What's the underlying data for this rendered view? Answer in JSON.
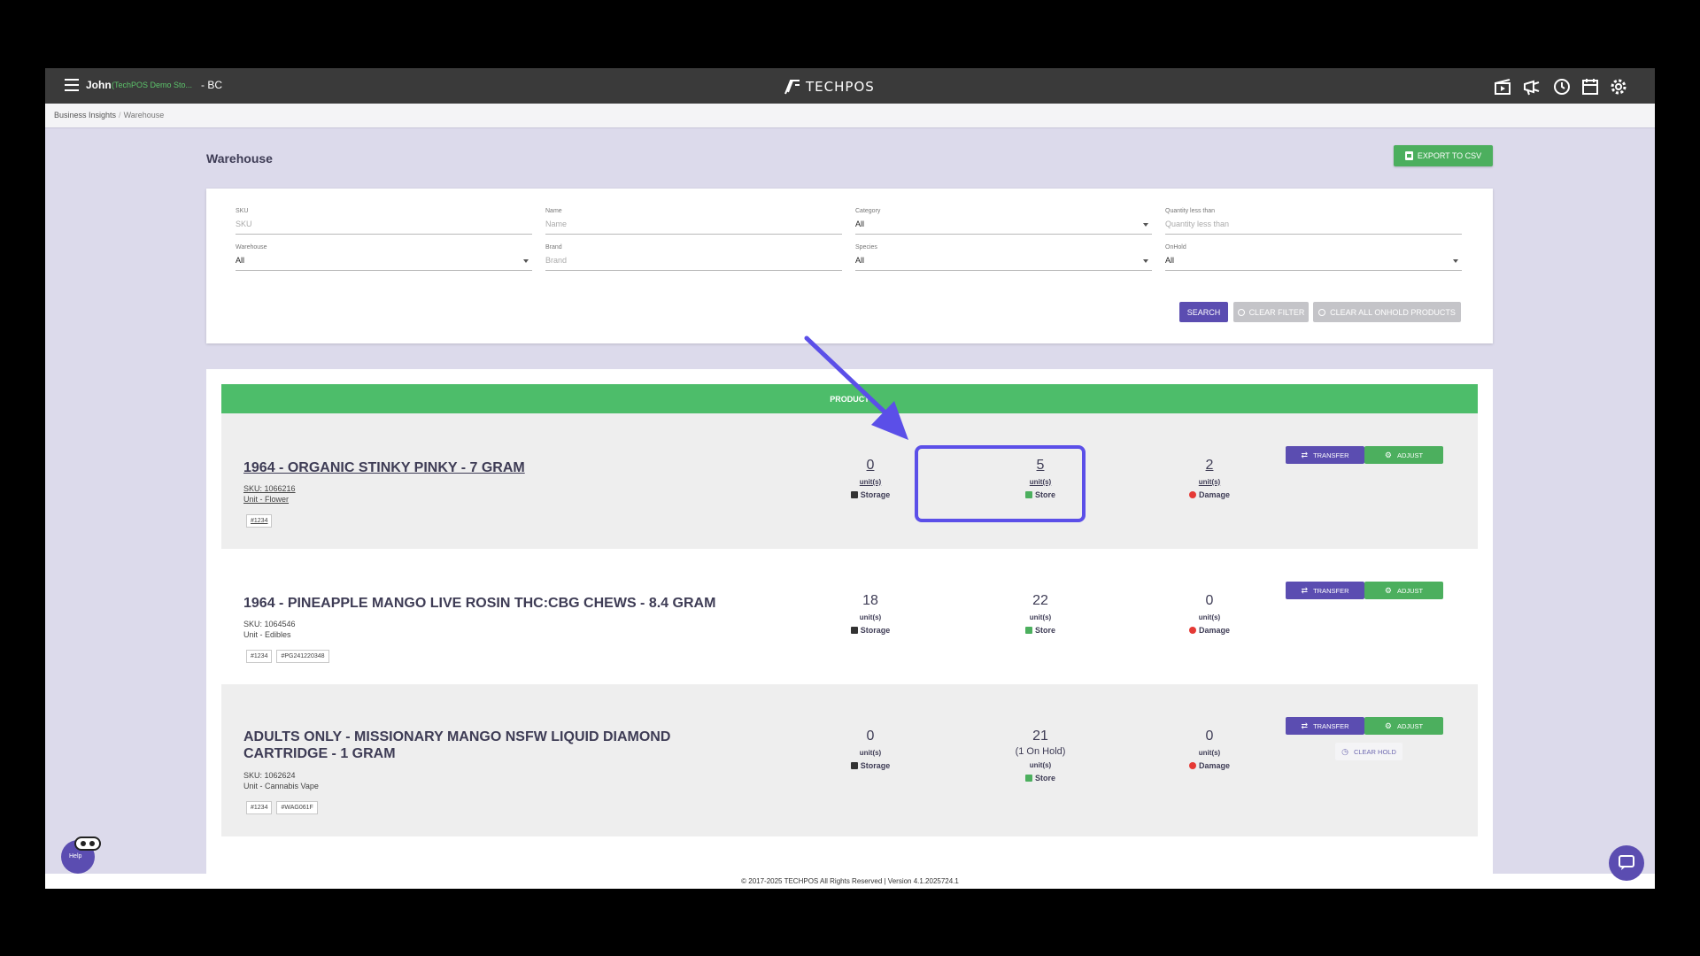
{
  "topbar": {
    "user": "John",
    "store": "(TechPOS Demo Sto...",
    "region": "- BC",
    "logo_text": "TECHPOS",
    "icons": [
      "film-icon",
      "megaphone-icon",
      "clock-icon",
      "calendar-icon",
      "gear-icon"
    ]
  },
  "breadcrumb": {
    "root": "Business Insights",
    "sep": "/",
    "current": "Warehouse"
  },
  "page": {
    "title": "Warehouse",
    "export_label": "EXPORT TO CSV"
  },
  "filters": {
    "sku": {
      "label": "SKU",
      "placeholder": "SKU"
    },
    "name": {
      "label": "Name",
      "placeholder": "Name"
    },
    "category": {
      "label": "Category",
      "value": "All"
    },
    "qty_less": {
      "label": "Quantity less than",
      "placeholder": "Quantity less than"
    },
    "warehouse": {
      "label": "Warehouse",
      "value": "All"
    },
    "brand": {
      "label": "Brand",
      "placeholder": "Brand"
    },
    "species": {
      "label": "Species",
      "value": "All"
    },
    "onhold": {
      "label": "OnHold",
      "value": "All"
    },
    "search_label": "SEARCH",
    "clear_filter_label": "CLEAR FILTER",
    "clear_onhold_label": "CLEAR ALL ONHOLD PRODUCTS"
  },
  "products": {
    "header": "PRODUCT",
    "units_label": "unit(s)",
    "storage_label": "Storage",
    "store_label": "Store",
    "damage_label": "Damage",
    "transfer_label": "TRANSFER",
    "adjust_label": "ADJUST",
    "clear_hold_label": "CLEAR HOLD",
    "items": [
      {
        "name": "1964 - ORGANIC STINKY PINKY - 7 GRAM",
        "sku": "SKU: 1066216",
        "unit": "Unit - Flower",
        "tags": [
          "#1234"
        ],
        "storage": "0",
        "store": "5",
        "damage": "2"
      },
      {
        "name": "1964 - PINEAPPLE MANGO LIVE ROSIN THC:CBG CHEWS - 8.4 GRAM",
        "sku": "SKU: 1064546",
        "unit": "Unit - Edibles",
        "tags": [
          "#1234",
          "#PG241220348"
        ],
        "storage": "18",
        "store": "22",
        "damage": "0"
      },
      {
        "name": "ADULTS ONLY - MISSIONARY MANGO NSFW LIQUID DIAMOND CARTRIDGE - 1 GRAM",
        "sku": "SKU: 1062624",
        "unit": "Unit - Cannabis Vape",
        "tags": [
          "#1234",
          "#WAG061F"
        ],
        "storage": "0",
        "store": "21",
        "store_hold": "(1 On Hold)",
        "damage": "0"
      }
    ]
  },
  "footer": "© 2017-2025 TECHPOS All Rights Reserved | Version 4.1.2025724.1",
  "help_label": "Help",
  "colors": {
    "accent": "#5b4db1",
    "green": "#4caf5e",
    "highlight": "#5b4fe8"
  }
}
